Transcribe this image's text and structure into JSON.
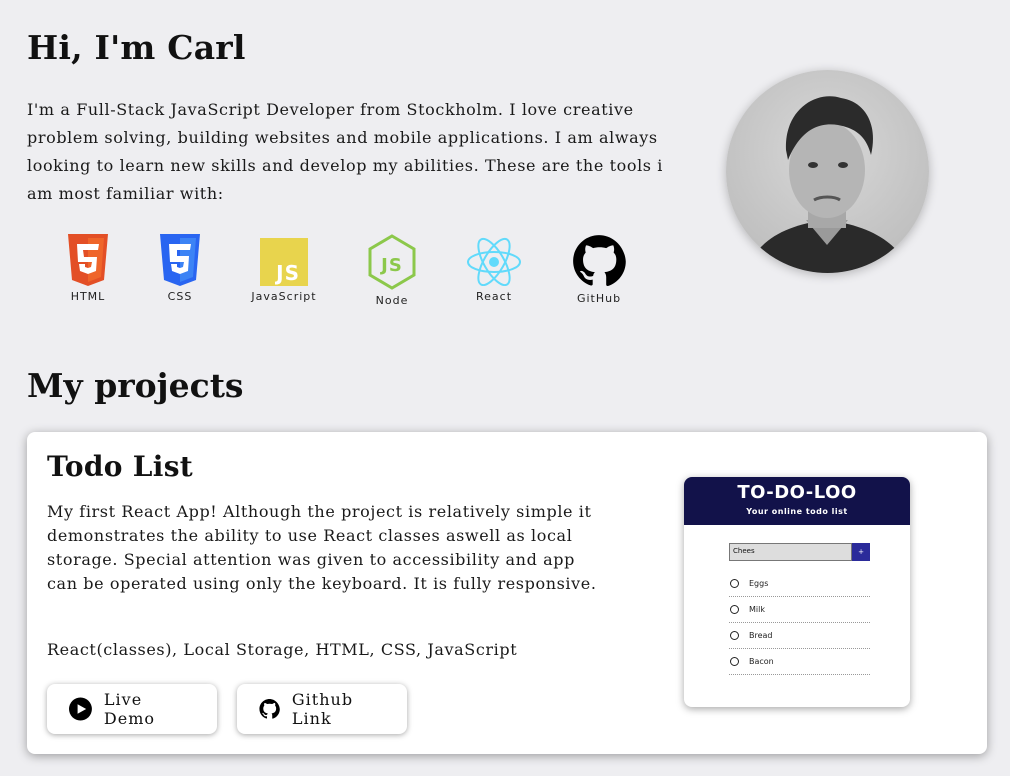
{
  "hero": {
    "title": "Hi, I'm Carl",
    "intro": "I'm a Full-Stack JavaScript Developer from Stockholm. I love creative problem solving, building websites and mobile applications. I am always looking to learn new skills and develop my abilities. These are the tools i am most familiar with:"
  },
  "tools": [
    {
      "label": "HTML",
      "icon": "html5-icon"
    },
    {
      "label": "CSS",
      "icon": "css3-icon"
    },
    {
      "label": "JavaScript",
      "icon": "javascript-icon"
    },
    {
      "label": "Node",
      "icon": "nodejs-icon"
    },
    {
      "label": "React",
      "icon": "react-icon"
    },
    {
      "label": "GitHub",
      "icon": "github-icon"
    }
  ],
  "projects": {
    "title": "My projects",
    "items": [
      {
        "title": "Todo List",
        "description": "My first React App! Although the project is relatively simple it demonstrates the ability to use React classes aswell as local storage. Special attention was given to accessibility and app can be operated using only the keyboard. It is fully responsive.",
        "tech": "React(classes), Local Storage, HTML, CSS, JavaScript",
        "demo_label": "Live Demo",
        "github_label": "Github Link",
        "preview": {
          "title": "TO-DO-LOO",
          "subtitle": "Your online todo list",
          "input_value": "Chees",
          "add_label": "+",
          "items": [
            "Eggs",
            "Milk",
            "Bread",
            "Bacon"
          ]
        }
      }
    ]
  },
  "colors": {
    "background": "#eeeef1",
    "preview_header": "#12124a",
    "html": "#e34f26",
    "css": "#2965f1",
    "js": "#e8d44d",
    "node": "#8cc84b",
    "react": "#61dafb"
  }
}
